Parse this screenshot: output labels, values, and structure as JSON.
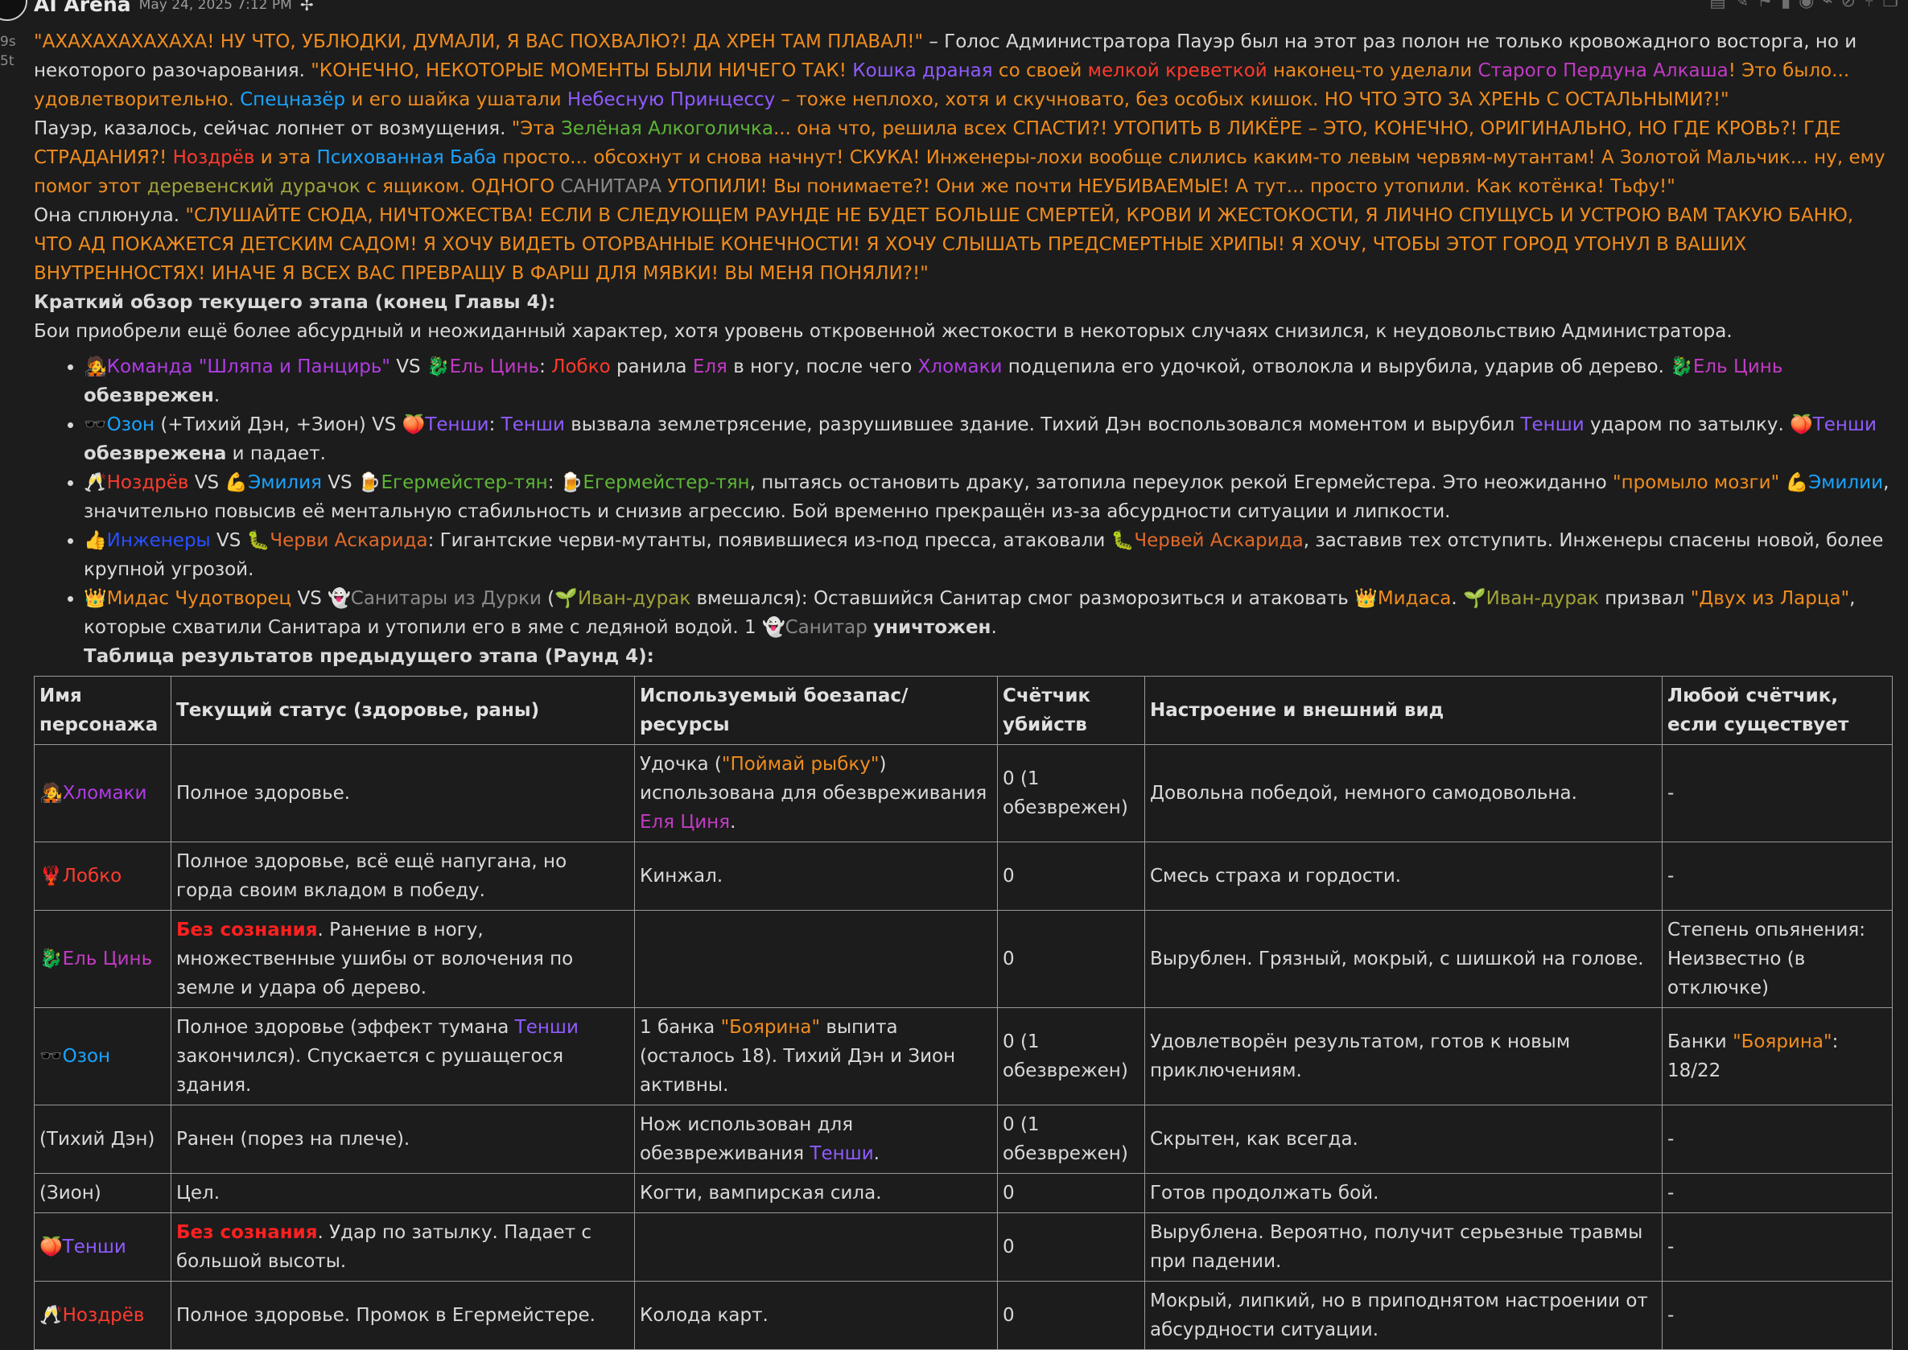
{
  "header": {
    "author": "AI Arena",
    "date": "May 24, 2025 7:12 PM",
    "gutter_lines": [
      "9s",
      "5t"
    ]
  },
  "icons": {
    "pin": "pin-icon",
    "toolbar": [
      "document-icon",
      "pencil-icon",
      "flag-icon",
      "bookmark-icon",
      "eye-icon",
      "paperclip-icon",
      "eye-off-icon",
      "branch-icon",
      "copy-icon"
    ]
  },
  "colors": {
    "background": "#1c1c1c",
    "text": "#d9d9d9",
    "orange": "#f08c1e",
    "purple": "#b03ce6",
    "red": "#ff3b2f",
    "blue": "#1aa3ff",
    "green": "#5db536"
  },
  "para1": {
    "t1": "\"АХАХАХАХАХАХА! НУ ЧТО, УБЛЮДКИ, ДУМАЛИ, Я ВАС ПОХВАЛЮ?! ДА ХРЕН ТАМ ПЛАВАЛ!\"",
    "t2": " – Голос Администратора Пауэр был на этот раз полон не только кровожадного восторга, но и некоторого разочарования. ",
    "t3": "\"КОНЕЧНО, НЕКОТОРЫЕ МОМЕНТЫ БЫЛИ НИЧЕГО ТАК! ",
    "t4": "Кошка драная",
    "t5": " со своей ",
    "t6": "мелкой креветкой",
    "t7": " наконец-то уделали ",
    "t8": "Старого Пердуна Алкаша",
    "t9": "! Это было... удовлетворительно. ",
    "t10": "Спецназёр",
    "t11": " и его шайка ушатали ",
    "t12": "Небесную Принцессу",
    "t13": " – тоже неплохо, хотя и скучновато, без особых кишок. НО ЧТО ЭТО ЗА ХРЕНЬ С ОСТАЛЬНЫМИ?!\""
  },
  "para2": {
    "t1": "Пауэр, казалось, сейчас лопнет от возмущения. ",
    "t2": "\"Эта ",
    "t3": "Зелёная Алкоголичка",
    "t4": "... она что, решила всех СПАСТИ?! УТОПИТЬ В ЛИКЁРЕ – ЭТО, КОНЕЧНО, ОРИГИНАЛЬНО, НО ГДЕ КРОВЬ?! ГДЕ СТРАДАНИЯ?! ",
    "t5": "Ноздрёв",
    "t6": " и эта ",
    "t7": "Психованная Баба",
    "t8": " просто... обсохнут и снова начнут! СКУКА! Инженеры-лохи вообще слились каким-то левым червям-мутантам! А Золотой Мальчик... ну, ему помог этот ",
    "t9": "деревенский дурачок",
    "t10": " с ящиком. ОДНОГО ",
    "t11": "САНИТАРА",
    "t12": " УТОПИЛИ! Вы понимаете?! Они же почти НЕУБИВАЕМЫЕ! А тут... просто утопили. Как котёнка! Тьфу!\""
  },
  "para3": {
    "t1": "Она сплюнула. ",
    "t2": "\"СЛУШАЙТЕ СЮДА, НИЧТОЖЕСТВА! ЕСЛИ В СЛЕДУЮЩЕМ РАУНДЕ НЕ БУДЕТ БОЛЬШЕ СМЕРТЕЙ, КРОВИ И ЖЕСТОКОСТИ, Я ЛИЧНО СПУЩУСЬ И УСТРОЮ ВАМ ТАКУЮ БАНЮ, ЧТО АД ПОКАЖЕТСЯ ДЕТСКИМ САДОМ! Я ХОЧУ ВИДЕТЬ ОТОРВАННЫЕ КОНЕЧНОСТИ! Я ХОЧУ СЛЫШАТЬ ПРЕДСМЕРТНЫЕ ХРИПЫ! Я ХОЧУ, ЧТОБЫ ЭТОТ ГОРОД УТОНУЛ В ВАШИХ ВНУТРЕННОСТЯХ! ИНАЧЕ Я ВСЕХ ВАС ПРЕВРАЩУ В ФАРШ ДЛЯ МЯВКИ! ВЫ МЕНЯ ПОНЯЛИ?!\""
  },
  "summary": {
    "heading": "Краткий обзор текущего этапа (конец Главы 4):",
    "text": "Бои приобрели ещё более абсурдный и неожиданный характер, хотя уровень откровенной жестокости в некоторых случаях снизился, к неудовольствию Администратора."
  },
  "bouts": {
    "b1": {
      "e1": "🧑‍🎤",
      "t1": "Команда \"Шляпа и Панцирь\"",
      "t2": " VS ",
      "e2": "🐉",
      "t3": "Ель Цинь",
      "t4": ": ",
      "t5": "Лобко",
      "t6": " ранила ",
      "t7": "Еля",
      "t8": " в ногу, после чего ",
      "t9": "Хломаки",
      "t10": " подцепила его удочкой, отволокла и вырубила, ударив об дерево. ",
      "e3": "🐉",
      "t11": "Ель Цинь",
      "t12": " ",
      "t13": "обезврежен",
      "t14": "."
    },
    "b2": {
      "e1": "🕶️",
      "t1": "Озон",
      "t2": " (+Тихий Дэн, +Зион) VS ",
      "e2": "🍑",
      "t3": "Тенши",
      "t4": ": ",
      "t5": "Тенши",
      "t6": " вызвала землетрясение, разрушившее здание. Тихий Дэн воспользовался моментом и вырубил ",
      "t7": "Тенши",
      "t8": " ударом по затылку. ",
      "e3": "🍑",
      "t9": "Тенши",
      "t10": " ",
      "t11": "обезврежена",
      "t12": " и падает."
    },
    "b3": {
      "e1": "🥂",
      "t1": "Ноздрёв",
      "t2": " VS ",
      "e2": "💪",
      "t3": "Эмилия",
      "t4": " VS ",
      "e3": "🍺",
      "t5": "Егермейстер-тян",
      "t6": ": ",
      "e4": "🍺",
      "t7": "Егермейстер-тян",
      "t8": ", пытаясь остановить драку, затопила переулок рекой Егермейстера. Это неожиданно ",
      "t9": "\"промыло мозги\"",
      "t10": " ",
      "e5": "💪",
      "t11": "Эмилии",
      "t12": ", значительно повысив её ментальную стабильность и снизив агрессию. Бой временно прекращён из-за абсурдности ситуации и липкости."
    },
    "b4": {
      "e1": "👍",
      "t1": "Инженеры",
      "t2": " VS ",
      "e2": "🐛",
      "t3": "Черви Аскарида",
      "t4": ": Гигантские черви-мутанты, появившиеся из-под пресса, атаковали ",
      "e3": "🐛",
      "t5": "Червей Аскарида",
      "t6": ", заставив тех отступить. Инженеры спасены новой, более крупной угрозой."
    },
    "b5": {
      "e1": "👑",
      "t1": "Мидас Чудотворец",
      "t2": " VS ",
      "e2": "👻",
      "t3": "Санитары из Дурки",
      "t4": " (",
      "e3": "🌱",
      "t5": "Иван-дурак",
      "t6": " вмешался): Оставшийся Санитар смог разморозиться и атаковать ",
      "e4": "👑",
      "t7": "Мидаса",
      "t8": ". ",
      "e5": "🌱",
      "t9": "Иван-дурак",
      "t10": " призвал ",
      "t11": "\"Двух из Ларца\"",
      "t12": ", которые схватили Санитара и утопили его в яме с ледяной водой. 1 ",
      "e6": "👻",
      "t13": "Санитар",
      "t14": " ",
      "t15": "уничтожен",
      "t16": "."
    }
  },
  "table": {
    "caption": "Таблица результатов предыдущего этапа (Раунд 4):",
    "headers": [
      "Имя персонажа",
      "Текущий статус (здоровье, раны)",
      "Используемый боезапас/ресурсы",
      "Счётчик убийств",
      "Настроение и внешний вид",
      "Любой счётчик, если существует"
    ],
    "rows": [
      {
        "emoji": "🧑‍🎤",
        "name": "Хломаки",
        "status": "Полное здоровье.",
        "res1": "Удочка (",
        "res2": "\"Поймай рыбку\"",
        "res3": ") использована для обезвреживания ",
        "res4": "Еля Циня",
        "res5": ".",
        "kills": "0 (1 обезврежен)",
        "mood": "Довольна победой, немного самодовольна.",
        "counter": "-"
      },
      {
        "emoji": "🦞",
        "name": "Лобко",
        "status": "Полное здоровье, всё ещё напугана, но горда своим вкладом в победу.",
        "res": "Кинжал.",
        "kills": "0",
        "mood": "Смесь страха и гордости.",
        "counter": "-"
      },
      {
        "emoji": "🐉",
        "name": "Ель Цинь",
        "status1": "Без сознания",
        "status2": ". Ранение в ногу, множественные ушибы от волочения по земле и удара об дерево.",
        "res": "",
        "kills": "0",
        "mood": "Вырублен. Грязный, мокрый, с шишкой на голове.",
        "counter": "Степень опьянения: Неизвестно (в отключке)"
      },
      {
        "emoji": "🕶️",
        "name": "Озон",
        "status1": "Полное здоровье (эффект тумана ",
        "status2": "Тенши",
        "status3": " закончился). Спускается с рушащегося здания.",
        "res1": "1 банка ",
        "res2": "\"Боярина\"",
        "res3": " выпита (осталось 18). Тихий Дэн и Зион активны.",
        "kills": "0 (1 обезврежен)",
        "mood": "Удовлетворён результатом, готов к новым приключениям.",
        "counter1": "Банки ",
        "counter2": "\"Боярина\"",
        "counter3": ": 18/22"
      },
      {
        "name": "(Тихий Дэн)",
        "status": "Ранен (порез на плече).",
        "res1": "Нож использован для обезвреживания ",
        "res2": "Тенши",
        "res3": ".",
        "kills": "0 (1 обезврежен)",
        "mood": "Скрытен, как всегда.",
        "counter": "-"
      },
      {
        "name": "(Зион)",
        "status": "Цел.",
        "res": "Когти, вампирская сила.",
        "kills": "0",
        "mood": "Готов продолжать бой.",
        "counter": "-"
      },
      {
        "emoji": "🍑",
        "name": "Тенши",
        "status1": "Без сознания",
        "status2": ". Удар по затылку. Падает с большой высоты.",
        "res": "",
        "kills": "0",
        "mood": "Вырублена. Вероятно, получит серьезные травмы при падении.",
        "counter": "-"
      },
      {
        "emoji": "🥂",
        "name": "Ноздрёв",
        "status": "Полное здоровье. Промок в Егермейстере.",
        "res": "Колода карт.",
        "kills": "0",
        "mood": "Мокрый, липкий, но в приподнятом настроении от абсурдности ситуации.",
        "counter": "-"
      }
    ]
  }
}
